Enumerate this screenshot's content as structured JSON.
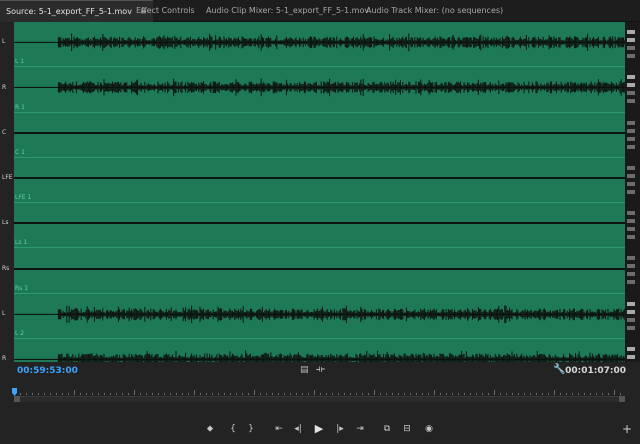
{
  "tabs": [
    {
      "label": "Source: 5-1_export_FF_5-1.mov",
      "active": true,
      "menu": "≡"
    },
    {
      "label": "Effect Controls",
      "active": false
    },
    {
      "label": "Audio Clip Mixer: 5-1_export_FF_5-1.mov",
      "active": false
    },
    {
      "label": "Audio Track Mixer: (no sequences)",
      "active": false
    }
  ],
  "channels": [
    {
      "label": "L",
      "sub": "L 1",
      "has_audio": true
    },
    {
      "label": "R",
      "sub": "R 1",
      "has_audio": true
    },
    {
      "label": "C",
      "sub": "C 1",
      "has_audio": false
    },
    {
      "label": "LFE",
      "sub": "LFE 1",
      "has_audio": false
    },
    {
      "label": "Ls",
      "sub": "Ls 1",
      "has_audio": false
    },
    {
      "label": "Rs",
      "sub": "Rs 1",
      "has_audio": false
    },
    {
      "label": "L",
      "sub": "L 2",
      "has_audio": true
    },
    {
      "label": "R",
      "sub": "R 2",
      "has_audio": true
    }
  ],
  "timecode": {
    "current": "00:59:53:00",
    "duration": "00:01:07:00"
  },
  "playhead_position": 0.0,
  "icons": {
    "drag_video": "film-icon",
    "drag_audio": "waveform-drag-icon",
    "settings": "wrench-icon",
    "add": "plus-icon"
  },
  "colors": {
    "waveform_bg": "#1e7a56",
    "timecode_accent": "#3aa4ff"
  },
  "transport": [
    {
      "name": "add-marker-button",
      "glyph": "⬥"
    },
    {
      "name": "mark-in-button",
      "glyph": "{"
    },
    {
      "name": "mark-out-button",
      "glyph": "}"
    },
    {
      "name": "go-to-in-button",
      "glyph": "⇤"
    },
    {
      "name": "step-back-button",
      "glyph": "◂|"
    },
    {
      "name": "play-button",
      "glyph": "▶"
    },
    {
      "name": "step-forward-button",
      "glyph": "|▸"
    },
    {
      "name": "go-to-out-button",
      "glyph": "⇥"
    },
    {
      "name": "insert-button",
      "glyph": "⧉"
    },
    {
      "name": "overwrite-button",
      "glyph": "⊟"
    },
    {
      "name": "export-frame-button",
      "glyph": "◉"
    }
  ],
  "add_button_glyph": "+"
}
